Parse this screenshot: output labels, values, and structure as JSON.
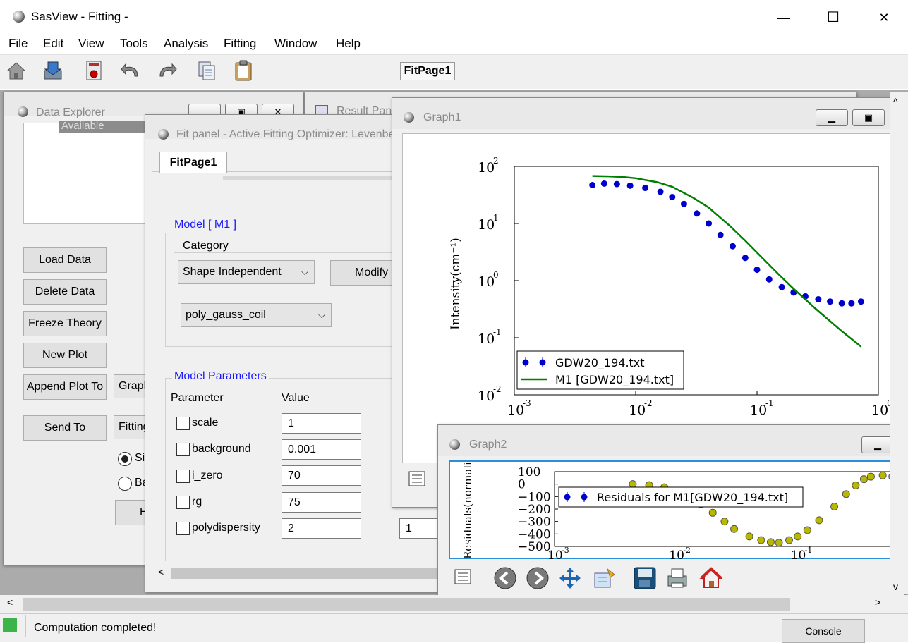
{
  "app": {
    "title": "SasView  - Fitting -"
  },
  "window_controls": {
    "minimize": "—",
    "maximize": "☐",
    "close": "✕"
  },
  "menu": [
    "File",
    "Edit",
    "View",
    "Tools",
    "Analysis",
    "Fitting",
    "Window",
    "Help"
  ],
  "toolbar": {
    "active_tab": "FitPage1"
  },
  "data_explorer": {
    "title": "Data Explorer",
    "tree_item": "Available Theories",
    "buttons": {
      "load": "Load Data",
      "delete": "Delete Data",
      "freeze": "Freeze Theory",
      "new_plot": "New Plot",
      "append": "Append Plot To",
      "send": "Send To"
    },
    "append_combo": "Graph",
    "send_combo": "Fitting",
    "radio_single": "Single",
    "radio_batch": "Batch",
    "help_button": "Help"
  },
  "result_panel": {
    "title": "Result Panel"
  },
  "fit_panel": {
    "title": "Fit panel - Active Fitting Optimizer: Levenberg-Marquardt",
    "tab": "FitPage1",
    "model_group": "Model [ M1 ]",
    "category_label": "Category",
    "category_value": "Shape Independent",
    "modify_button": "Modify",
    "model_value": "poly_gauss_coil",
    "params_group": "Model Parameters",
    "col_parameter": "Parameter",
    "col_value": "Value",
    "params": [
      {
        "name": "scale",
        "value": "1"
      },
      {
        "name": "background",
        "value": "0.001"
      },
      {
        "name": "i_zero",
        "value": "70"
      },
      {
        "name": "rg",
        "value": "75"
      },
      {
        "name": "polydispersity",
        "value": "2"
      }
    ],
    "poly_extra_value": "1"
  },
  "graph1": {
    "title": "Graph1",
    "chart_data": {
      "type": "line",
      "xscale": "log",
      "yscale": "log",
      "xlim": [
        0.001,
        1.0
      ],
      "ylim": [
        0.01,
        100
      ],
      "ylabel": "Intensity(cm⁻¹)",
      "x_ticks": [
        "10",
        "10",
        "10",
        "10"
      ],
      "x_tick_exps": [
        "-3",
        "-2",
        "-1",
        "0"
      ],
      "y_ticks": [
        "10",
        "10",
        "10",
        "10",
        "10"
      ],
      "y_tick_exps": [
        "2",
        "1",
        "0",
        "-1",
        "-2"
      ],
      "legend_position": "lower-left",
      "series": [
        {
          "name": "GDW20_194.txt",
          "style": "markers-errorbars",
          "color": "#0000cc",
          "x": [
            0.0044,
            0.0055,
            0.007,
            0.009,
            0.012,
            0.016,
            0.02,
            0.025,
            0.032,
            0.04,
            0.05,
            0.063,
            0.08,
            0.1,
            0.126,
            0.16,
            0.2,
            0.25,
            0.32,
            0.4,
            0.5,
            0.6,
            0.72
          ],
          "y": [
            47,
            50,
            49,
            46,
            42,
            36,
            29,
            22,
            15,
            10,
            6.3,
            4.0,
            2.5,
            1.55,
            1.05,
            0.77,
            0.62,
            0.53,
            0.47,
            0.43,
            0.4,
            0.4,
            0.43
          ]
        },
        {
          "name": "M1 [GDW20_194.txt]",
          "style": "line",
          "color": "#008000",
          "x": [
            0.0044,
            0.006,
            0.008,
            0.01,
            0.015,
            0.02,
            0.03,
            0.04,
            0.06,
            0.08,
            0.1,
            0.15,
            0.2,
            0.3,
            0.5,
            0.72
          ],
          "y": [
            68,
            67,
            65,
            62,
            53,
            44,
            28,
            19,
            9.0,
            5.0,
            3.1,
            1.3,
            0.72,
            0.33,
            0.13,
            0.07
          ]
        }
      ]
    }
  },
  "graph2": {
    "title": "Graph2",
    "chart_data": {
      "type": "scatter",
      "xscale": "log",
      "xlim": [
        0.001,
        1.0
      ],
      "ylim": [
        -500,
        100
      ],
      "ylabel": "Residuals(normalized)",
      "y_ticks": [
        "100",
        "0",
        "−100",
        "−200",
        "−300",
        "−400",
        "−500"
      ],
      "x_ticks": [
        "10",
        "10",
        "10"
      ],
      "x_tick_exps": [
        "-3",
        "-2",
        "-1"
      ],
      "series": [
        {
          "name": "Residuals for M1[GDW20_194.txt]",
          "color": "#b8b800",
          "x": [
            0.0044,
            0.006,
            0.008,
            0.01,
            0.013,
            0.016,
            0.02,
            0.025,
            0.03,
            0.04,
            0.05,
            0.06,
            0.07,
            0.085,
            0.1,
            0.12,
            0.15,
            0.2,
            0.25,
            0.3,
            0.35,
            0.4,
            0.5,
            0.6,
            0.72
          ],
          "y": [
            0,
            -8,
            -25,
            -55,
            -100,
            -160,
            -230,
            -300,
            -360,
            -420,
            -450,
            -465,
            -470,
            -450,
            -420,
            -370,
            -290,
            -180,
            -80,
            -10,
            40,
            60,
            70,
            60,
            40
          ]
        }
      ]
    }
  },
  "status": {
    "text": "Computation  completed!",
    "console_button": "Console"
  }
}
